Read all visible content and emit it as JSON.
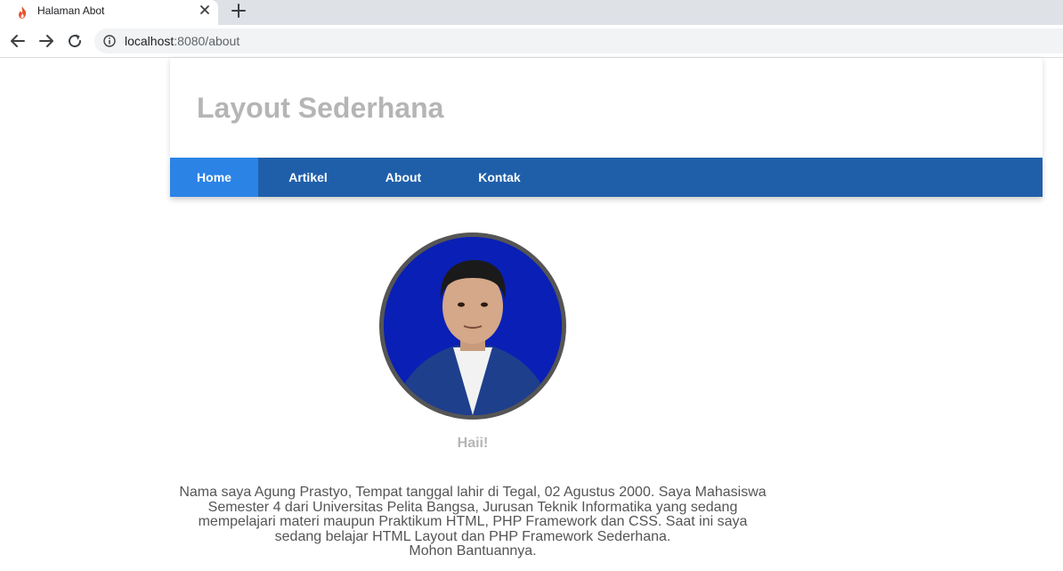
{
  "browser": {
    "tab_title": "Halaman Abot",
    "url_host": "localhost",
    "url_rest": ":8080/about"
  },
  "site": {
    "title": "Layout Sederhana",
    "nav": [
      {
        "label": "Home",
        "active": true
      },
      {
        "label": "Artikel",
        "active": false
      },
      {
        "label": "About",
        "active": false
      },
      {
        "label": "Kontak",
        "active": false
      }
    ]
  },
  "about": {
    "greeting": "Haii!",
    "bio_lines": [
      "Nama saya Agung Prastyo, Tempat tanggal lahir di Tegal, 02 Agustus 2000. Saya Mahasiswa",
      "Semester 4 dari Universitas Pelita Bangsa, Jurusan Teknik Informatika yang sedang",
      "mempelajari materi maupun Praktikum HTML, PHP Framework dan CSS. Saat ini saya",
      "sedang belajar HTML Layout dan PHP Framework Sederhana.",
      "Mohon Bantuannya."
    ]
  },
  "colors": {
    "nav_bar": "#1f5faa",
    "nav_active": "#2b83e6",
    "title_gray": "#b5b5b5",
    "photo_bg": "#0a1fb5"
  }
}
